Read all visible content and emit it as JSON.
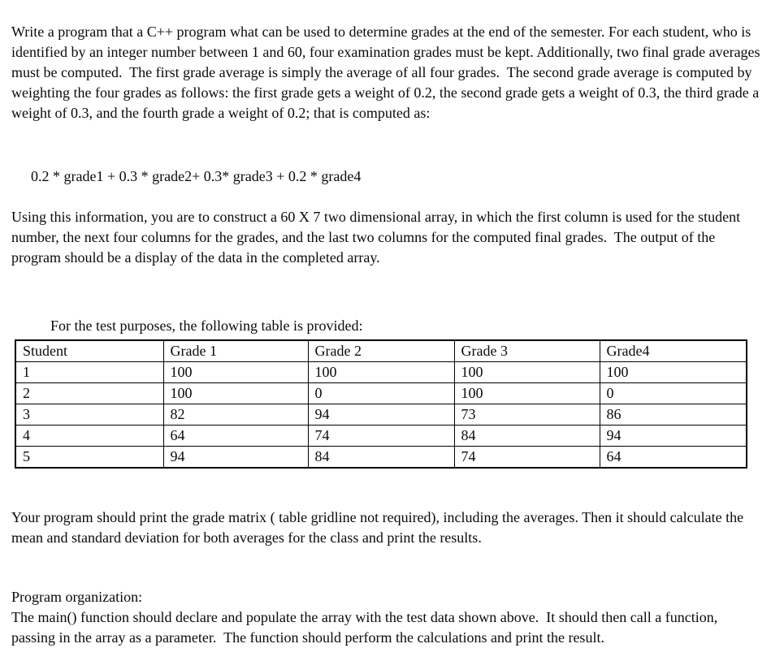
{
  "document": {
    "background_color": "#ffffff",
    "text_color": "#0a0a0a",
    "paragraphs": {
      "intro": "Write a program that a C++ program what can be used to determine grades at the end of the semester. For each student, who is identified by an integer number between 1 and 60, four examination grades must be kept. Additionally, two final grade averages must be computed.  The first grade average is simply the average of all four grades.  The second grade average is computed by weighting the four grades as follows: the first grade gets a weight of 0.2, the second grade gets a weight of 0.3, the third grade a weight of 0.3, and the fourth grade a weight of 0.2; that is computed as:",
      "formula": "0.2 * grade1 + 0.3 * grade2+ 0.3* grade3 + 0.2 * grade4",
      "array_construction": "Using this information, you are to construct a 60 X 7 two dimensional array, in which the first column is used for the student number, the next four columns for the grades, and the last two columns for the computed final grades.  The output of the program should be a display of the data in the completed array.",
      "table_lead_in": "For the test purposes, the following table is provided:",
      "print_requirements": "Your program should print the grade matrix ( table gridline not required), including the averages. Then it should calculate the mean and standard deviation for both averages for the class and print the results.",
      "program_organization_title": "Program organization:",
      "program_organization_body": "The main() function should declare and populate the array with the test data shown above.  It should then call a function, passing in the array as a parameter.  The function should perform the calculations and print the result."
    }
  },
  "grade_table": {
    "border_color": "#000000",
    "headers": [
      "Student",
      "Grade 1",
      "Grade 2",
      "Grade 3",
      "Grade4"
    ],
    "rows": [
      [
        "1",
        "100",
        "100",
        "100",
        "100"
      ],
      [
        "2",
        "100",
        "0",
        "100",
        "0"
      ],
      [
        "3",
        "82",
        "94",
        "73",
        "86"
      ],
      [
        "4",
        "64",
        "74",
        "84",
        "94"
      ],
      [
        "5",
        "94",
        "84",
        "74",
        "64"
      ]
    ]
  }
}
